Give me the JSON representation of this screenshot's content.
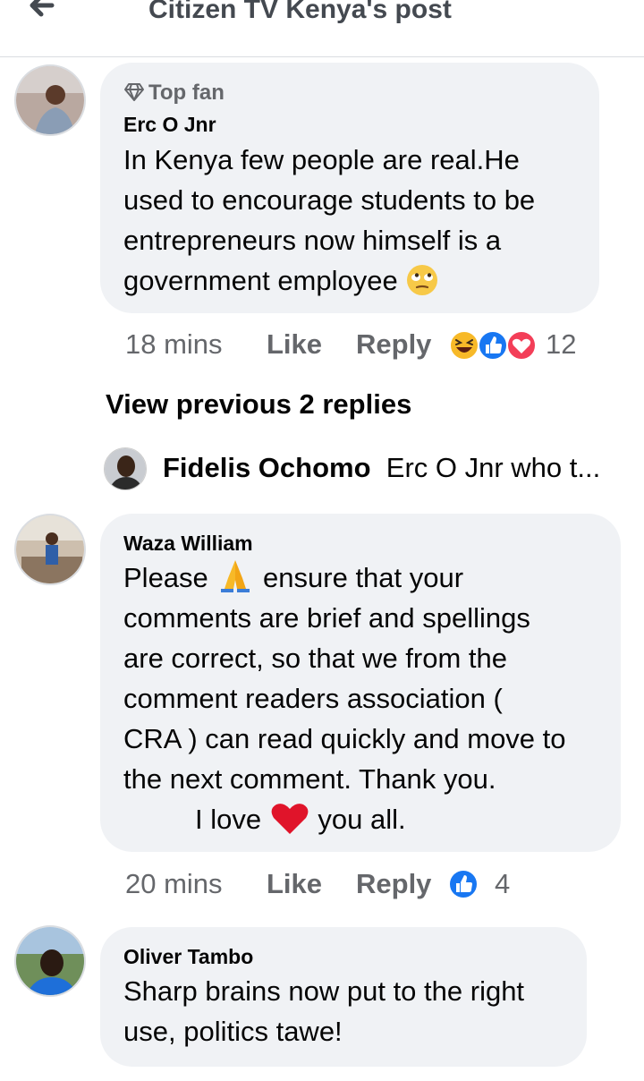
{
  "header": {
    "title": "Citizen TV Kenya's post",
    "back_icon": "arrow-left-icon"
  },
  "comments": [
    {
      "badge": "Top fan",
      "author": "Erc O Jnr",
      "lines": [
        "In Kenya few people are real.He",
        "used to encourage students to be",
        "entrepreneurs now himself is a",
        "government employee"
      ],
      "time": "18 mins",
      "like_label": "Like",
      "reply_label": "Reply",
      "reactions": [
        "haha",
        "like",
        "love"
      ],
      "reaction_count": "12"
    },
    {
      "author": "Waza William",
      "lines": [
        "Please",
        "ensure that your",
        "comments are brief and spellings",
        "are correct, so that we from the",
        "comment readers association (",
        "CRA ) can read quickly and move to",
        "the next comment. Thank you.",
        "I love",
        "you all."
      ],
      "time": "20 mins",
      "like_label": "Like",
      "reply_label": "Reply",
      "reactions": [
        "like"
      ],
      "reaction_count": "4"
    },
    {
      "author": "Oliver Tambo",
      "lines": [
        "Sharp brains now put to the right",
        "use, politics tawe!"
      ]
    }
  ],
  "replies": {
    "view_previous": "View previous 2 replies",
    "preview_author": "Fidelis Ochomo",
    "preview_text": "Erc O Jnr who t..."
  },
  "colors": {
    "bubble": "#f0f2f5",
    "meta": "#65676b",
    "like_blue": "#1877f2",
    "love_red": "#f33e58",
    "haha_yellow": "#f7b928"
  }
}
